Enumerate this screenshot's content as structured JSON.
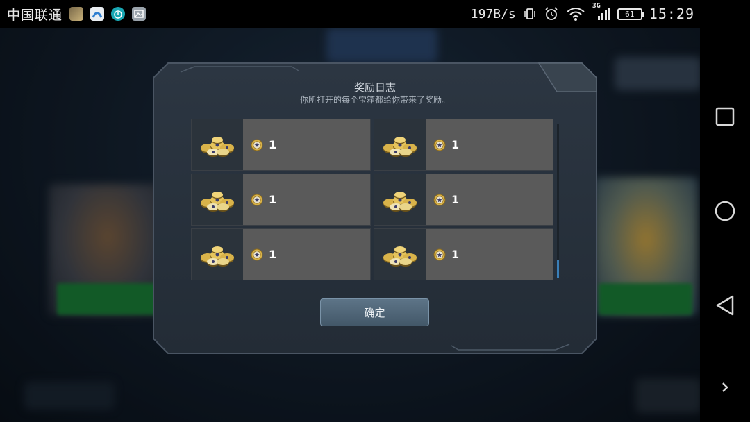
{
  "status_bar": {
    "carrier": "中国联通",
    "net_speed": "197B/s",
    "network_type": "3G",
    "battery": "61",
    "time": "15:29",
    "app_icons": [
      "game-app-icon",
      "browser-app-icon",
      "timer-app-icon",
      "gallery-app-icon"
    ]
  },
  "dialog": {
    "title": "奖励日志",
    "subtitle": "你所打开的每个宝箱都给你带来了奖励。",
    "confirm_label": "确定",
    "rewards": [
      {
        "icon": "coin-pile-icon",
        "currency_icon": "coin-icon",
        "quantity": "1"
      },
      {
        "icon": "coin-pile-icon",
        "currency_icon": "coin-icon",
        "quantity": "1"
      },
      {
        "icon": "coin-pile-icon",
        "currency_icon": "coin-icon",
        "quantity": "1"
      },
      {
        "icon": "coin-pile-icon",
        "currency_icon": "coin-icon",
        "quantity": "1"
      },
      {
        "icon": "coin-pile-icon",
        "currency_icon": "coin-icon",
        "quantity": "1"
      },
      {
        "icon": "coin-pile-icon",
        "currency_icon": "coin-icon",
        "quantity": "1"
      }
    ]
  },
  "nav_bar": [
    "recent-apps-icon",
    "home-icon",
    "back-icon",
    "expand-icon"
  ],
  "colors": {
    "dialog_bg": "#27313c",
    "cell_bg": "#5a5a5a",
    "button": "#4f6577",
    "scroll_thumb": "#3a7fb8",
    "gold": "#d9b34a"
  }
}
